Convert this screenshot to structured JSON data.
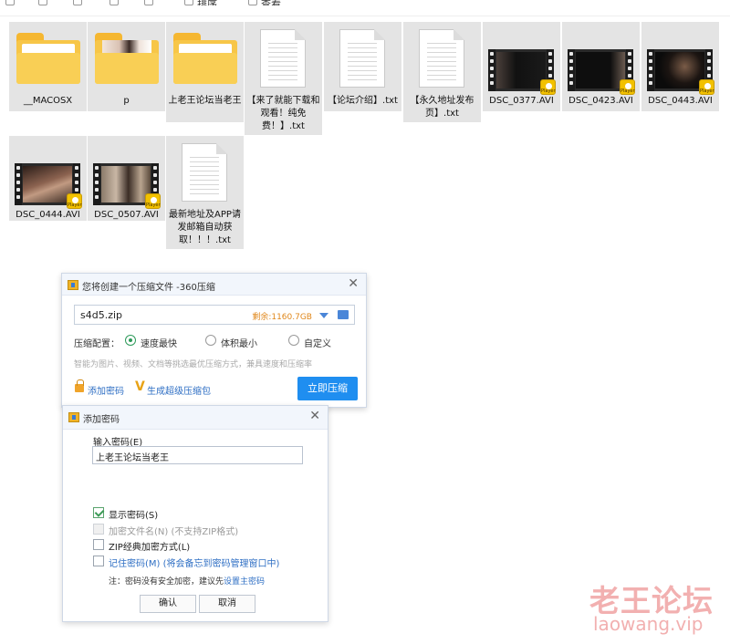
{
  "toolbar": {
    "items": [
      {
        "label": "",
        "icon": "new-item-icon"
      },
      {
        "label": "",
        "icon": "copy-icon"
      },
      {
        "label": "",
        "icon": "share-icon"
      },
      {
        "label": "",
        "icon": "rename-icon"
      },
      {
        "label": "",
        "icon": "delete-icon"
      },
      {
        "label": "排序",
        "icon": "sort-icon"
      },
      {
        "label": "查看",
        "icon": "view-icon"
      }
    ]
  },
  "files": [
    {
      "name": "__MACOSX",
      "type": "folder"
    },
    {
      "name": "p",
      "type": "folder-photo"
    },
    {
      "name": "上老王论坛当老王",
      "type": "folder"
    },
    {
      "name": "【来了就能下载和观看！纯免费！】.txt",
      "type": "txt"
    },
    {
      "name": "【论坛介绍】.txt",
      "type": "txt"
    },
    {
      "name": "【永久地址发布页】.txt",
      "type": "txt"
    },
    {
      "name": "DSC_0377.AVI",
      "type": "video"
    },
    {
      "name": "DSC_0423.AVI",
      "type": "video"
    },
    {
      "name": "DSC_0443.AVI",
      "type": "video"
    },
    {
      "name": "DSC_0444.AVI",
      "type": "video"
    },
    {
      "name": "DSC_0507.AVI",
      "type": "video"
    },
    {
      "name": "最新地址及APP请发邮箱自动获取！！！.txt",
      "type": "txt"
    }
  ],
  "video_badge_text": "Player",
  "compress_dialog": {
    "title": "您将创建一个压缩文件 -360压缩",
    "filename": "s4d5.zip",
    "free_space": "剩余:1160.7GB",
    "config_label": "压缩配置：",
    "options": [
      "速度最快",
      "体积最小",
      "自定义"
    ],
    "selected_option": "速度最快",
    "hint": "智能为图片、视频、文档等挑选最优压缩方式，兼具速度和压缩率",
    "add_password": "添加密码",
    "super_package": "生成超级压缩包",
    "compress_now": "立即压缩"
  },
  "password_dialog": {
    "title": "添加密码",
    "input_label": "输入密码(E)",
    "password_value": "上老王论坛当老王",
    "show_password": "显示密码(S)",
    "show_password_checked": true,
    "encrypt_filename": "加密文件名(N) (不支持ZIP格式)",
    "encrypt_filename_enabled": false,
    "zip_classic": "ZIP经典加密方式(L)",
    "zip_classic_checked": false,
    "remember_password": "记住密码(M) (将会备忘到密码管理窗口中)",
    "remember_password_checked": false,
    "note_prefix": "注：密码没有安全加密，建议先",
    "note_link": "设置主密码",
    "ok": "确认",
    "cancel": "取消"
  },
  "watermark": {
    "line1": "老王论坛",
    "line2": "laowang.vip"
  }
}
